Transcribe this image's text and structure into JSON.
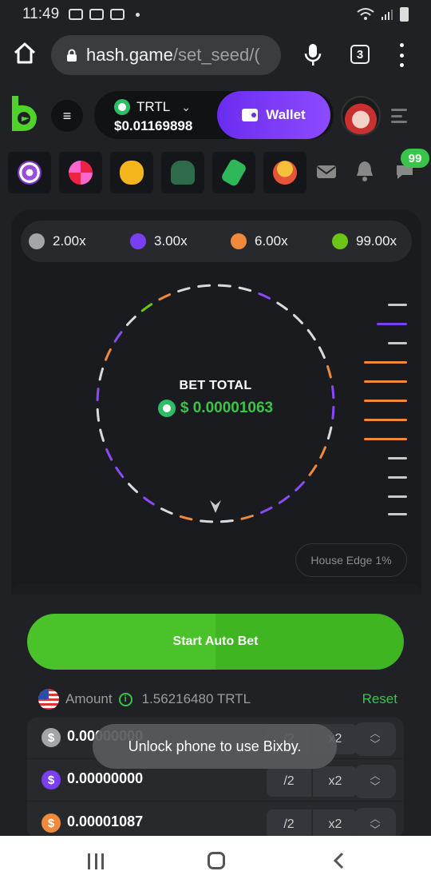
{
  "status_bar": {
    "time": "11:49"
  },
  "browser": {
    "url_host": "hash.game",
    "url_path": "/set_seed/(",
    "tab_count": "3"
  },
  "header": {
    "currency": "TRTL",
    "balance": "$0.01169898",
    "wallet_label": "Wallet"
  },
  "games_row": {
    "icons": [
      "star-target-icon",
      "wheel-icon",
      "piggy-bank-icon",
      "alien-icon",
      "price-tag-icon",
      "coin-stack-icon",
      "mail-icon",
      "bell-icon",
      "chat-icon"
    ],
    "chat_badge": "99"
  },
  "multipliers": [
    {
      "label": "2.00x",
      "color": "#a3a5aa"
    },
    {
      "label": "3.00x",
      "color": "#7b3ff2"
    },
    {
      "label": "6.00x",
      "color": "#f08a3a"
    },
    {
      "label": "99.00x",
      "color": "#6cc417"
    }
  ],
  "wheel": {
    "title": "BET TOTAL",
    "value": "$ 0.00001063"
  },
  "house_edge": "House Edge 1%",
  "start_button": "Start Auto Bet",
  "amount": {
    "label": "Amount",
    "value": "1.56216480 TRTL",
    "reset": "Reset"
  },
  "coin_rows": [
    {
      "symbol": "$",
      "value": "0.00000000",
      "color": "#a3a5aa"
    },
    {
      "symbol": "$",
      "value": "0.00000000",
      "color": "#7b3ff2"
    },
    {
      "symbol": "$",
      "value": "0.00001087",
      "color": "#f08a3a"
    }
  ],
  "controls": {
    "half": "/2",
    "double": "x2"
  },
  "toast": "Unlock phone to use Bixby."
}
